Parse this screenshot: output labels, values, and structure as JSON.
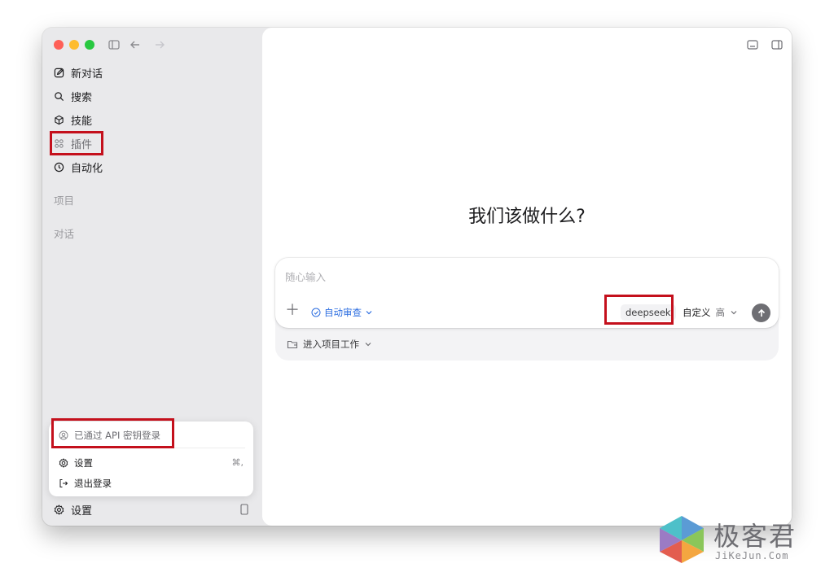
{
  "sidebar": {
    "items": [
      {
        "label": "新对话",
        "icon": "edit-icon"
      },
      {
        "label": "搜索",
        "icon": "search-icon"
      },
      {
        "label": "技能",
        "icon": "cube-icon"
      },
      {
        "label": "插件",
        "icon": "grid-icon"
      },
      {
        "label": "自动化",
        "icon": "clock-icon"
      }
    ],
    "sections": {
      "projects": "项目",
      "conversations": "对话"
    },
    "settings_label": "设置"
  },
  "account_menu": {
    "status": "已通过 API 密钥登录",
    "settings": "设置",
    "settings_shortcut": "⌘,",
    "logout": "退出登录"
  },
  "main": {
    "headline": "我们该做什么?",
    "composer": {
      "placeholder": "随心输入",
      "auto_review": "自动审查",
      "model": "deepseek",
      "mode": "自定义",
      "level": "高"
    },
    "project_button": "进入项目工作"
  },
  "watermark": {
    "brand": "极客君",
    "site": "JiKeJun.Com"
  },
  "colors": {
    "highlight": "#c4101c",
    "accent": "#2b6de0",
    "sidebar_bg": "#e9e9eb"
  }
}
